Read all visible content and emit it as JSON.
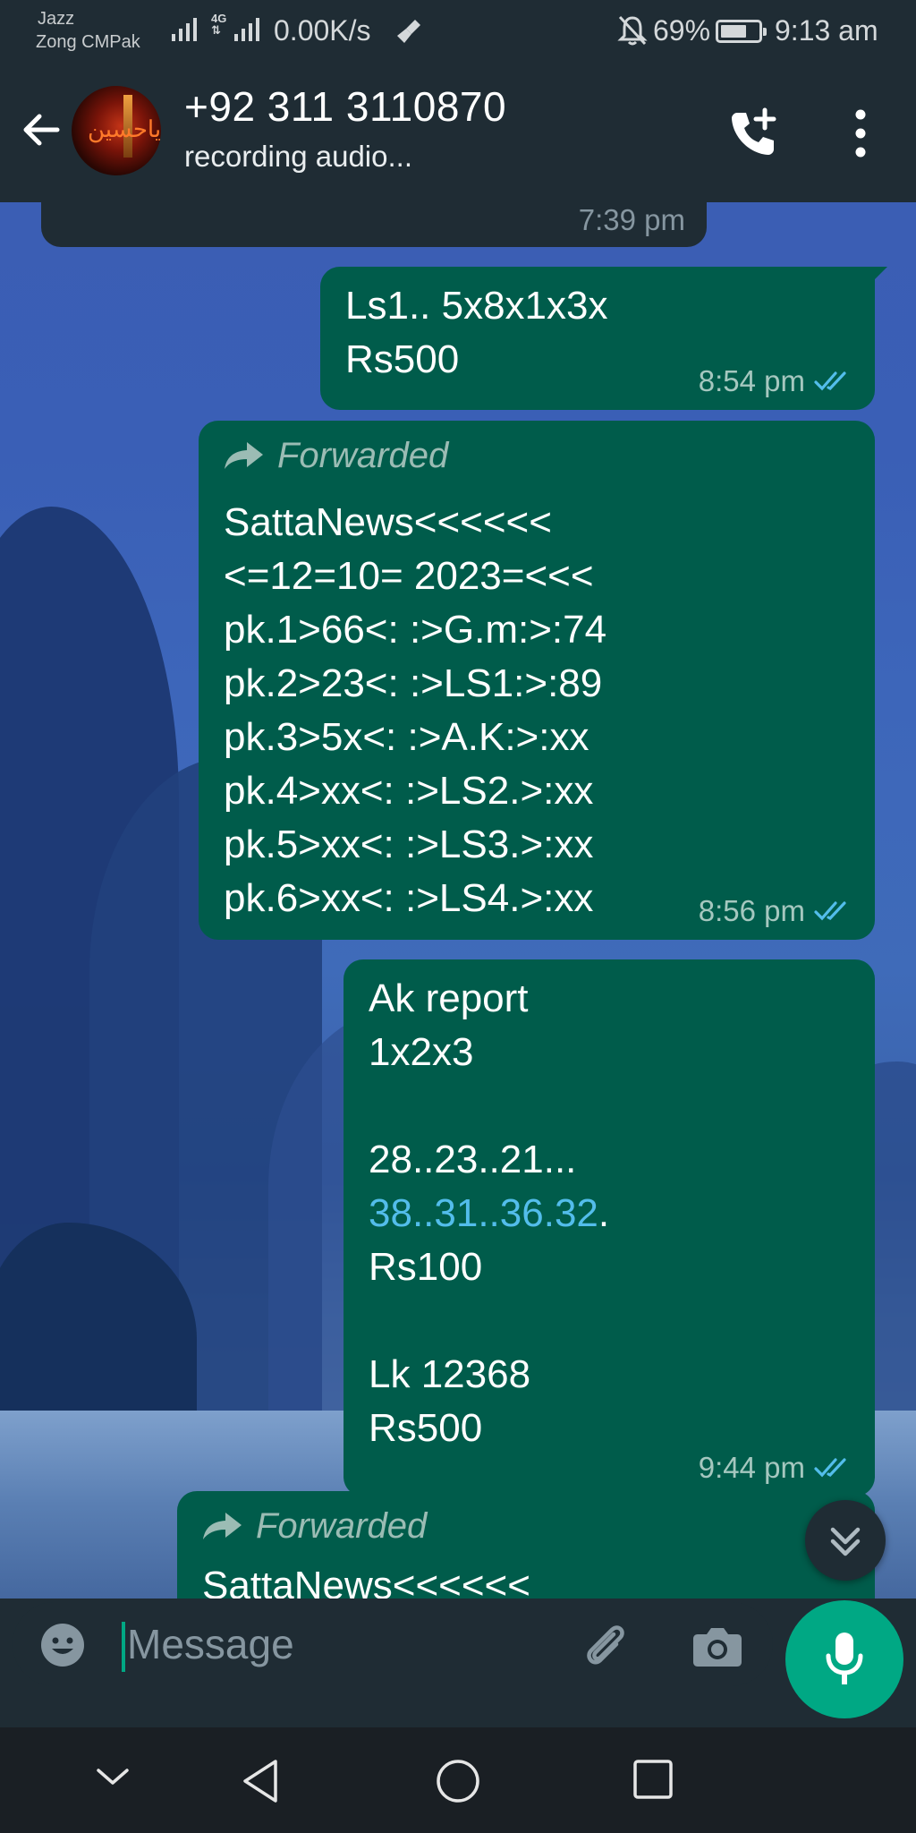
{
  "status_bar": {
    "carrier_1": "Jazz",
    "carrier_2": "Zong CMPak",
    "network": "4G",
    "speed": "0.00K/s",
    "battery": "69%",
    "battery_level": 0.69,
    "time": "9:13 am"
  },
  "header": {
    "contact": "+92 311 3110870",
    "status": "recording audio..."
  },
  "messages": [
    {
      "time": "7:39 pm"
    },
    {
      "text": "Ls1.. 5x8x1x3x\nRs500",
      "time": "8:54 pm"
    },
    {
      "forwarded": "Forwarded",
      "text": "SattaNews<<<<<<\n<=12=10= 2023=<<<\npk.1>66<: :>G.m:>:74\npk.2>23<: :>LS1:>:89\npk.3>5x<: :>A.K:>:xx\npk.4>xx<: :>LS2.>:xx\npk.5>xx<: :>LS3.>:xx\npk.6>xx<: :>LS4.>:xx",
      "time": "8:56 pm"
    },
    {
      "line1": "Ak report",
      "line2": "1x2x3",
      "line3": "28..23..21...",
      "link": "38..31..36.32",
      "after_link": ".",
      "line5": "Rs100",
      "line6": "Lk 12368",
      "line7": "Rs500",
      "time": "9:44 pm"
    },
    {
      "forwarded": "Forwarded",
      "preview": "SattaNews<<<<<<"
    }
  ],
  "composer": {
    "placeholder": "Message"
  },
  "colors": {
    "header": "#1f2c34",
    "outgoing_bubble": "#005c4b",
    "accent": "#00a884",
    "read_ticks": "#53bdeb"
  },
  "icons": [
    "back-arrow-icon",
    "add-call-icon",
    "more-options-icon",
    "forward-icon",
    "double-check-icon",
    "chevron-double-down-icon",
    "emoji-icon",
    "attach-icon",
    "camera-icon",
    "mic-icon",
    "nav-down-icon",
    "nav-back-icon",
    "nav-home-icon",
    "nav-recents-icon"
  ]
}
